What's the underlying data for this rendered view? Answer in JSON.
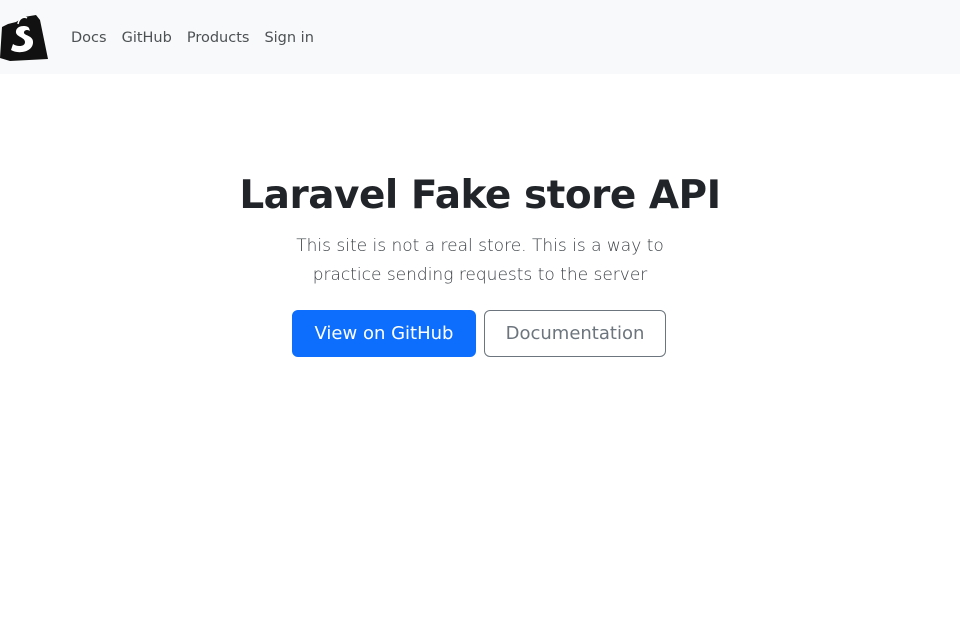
{
  "navbar": {
    "brand_icon": "shopping-bag-s-logo",
    "links": [
      {
        "label": "Docs"
      },
      {
        "label": "GitHub"
      },
      {
        "label": "Products"
      },
      {
        "label": "Sign in"
      }
    ]
  },
  "hero": {
    "title": "Laravel Fake store API",
    "lead": "This site is not a real store. This is a way to practice sending requests to the server",
    "buttons": {
      "primary_label": "View on GitHub",
      "secondary_label": "Documentation"
    }
  },
  "colors": {
    "primary": "#0d6efd",
    "secondary": "#6c757d",
    "navbar_bg": "#f8f9fa"
  }
}
